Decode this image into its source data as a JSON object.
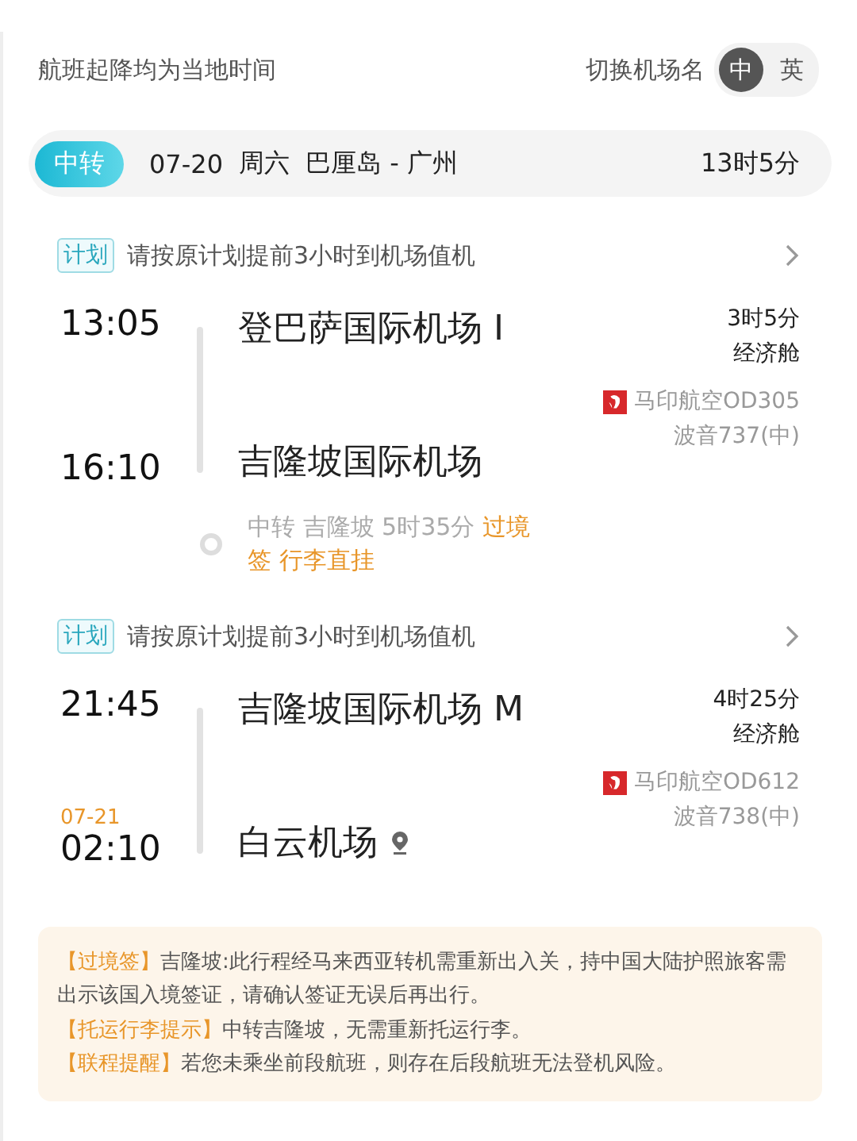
{
  "header": {
    "note": "航班起降均为当地时间",
    "switch_label": "切换机场名",
    "languages": [
      {
        "label": "中",
        "selected": true
      },
      {
        "label": "英",
        "selected": false
      }
    ]
  },
  "trip": {
    "badge": "中转",
    "date": "07-20",
    "weekday": "周六",
    "route": "巴厘岛 - 广州",
    "duration": "13时5分"
  },
  "segments": [
    {
      "plan_tag": "计划",
      "plan_text": "请按原计划提前3小时到机场值机",
      "dep_time": "13:05",
      "dep_airport": "登巴萨国际机场 I",
      "arr_time": "16:10",
      "arr_airport": "吉隆坡国际机场",
      "duration": "3时5分",
      "cabin": "经济舱",
      "flight": "马印航空OD305",
      "aircraft": "波音737(中)",
      "transfer": {
        "info": "中转 吉隆坡 5时35分",
        "tags": "过境签 行李直挂"
      }
    },
    {
      "plan_tag": "计划",
      "plan_text": "请按原计划提前3小时到机场值机",
      "dep_time": "21:45",
      "dep_airport": "吉隆坡国际机场 M",
      "arr_date": "07-21",
      "arr_time": "02:10",
      "arr_airport": "白云机场",
      "arr_pin": true,
      "duration": "4时25分",
      "cabin": "经济舱",
      "flight": "马印航空OD612",
      "aircraft": "波音738(中)"
    }
  ],
  "notices": [
    {
      "label": "【过境签】",
      "text": "吉隆坡:此行程经马来西亚转机需重新出入关，持中国大陆护照旅客需出示该国入境签证，请确认签证无误后再出行。"
    },
    {
      "label": "【托运行李提示】",
      "text": "中转吉隆坡，无需重新托运行李。"
    },
    {
      "label": "【联程提醒】",
      "text": "若您未乘坐前段航班，则存在后段航班无法登机风险。"
    }
  ]
}
